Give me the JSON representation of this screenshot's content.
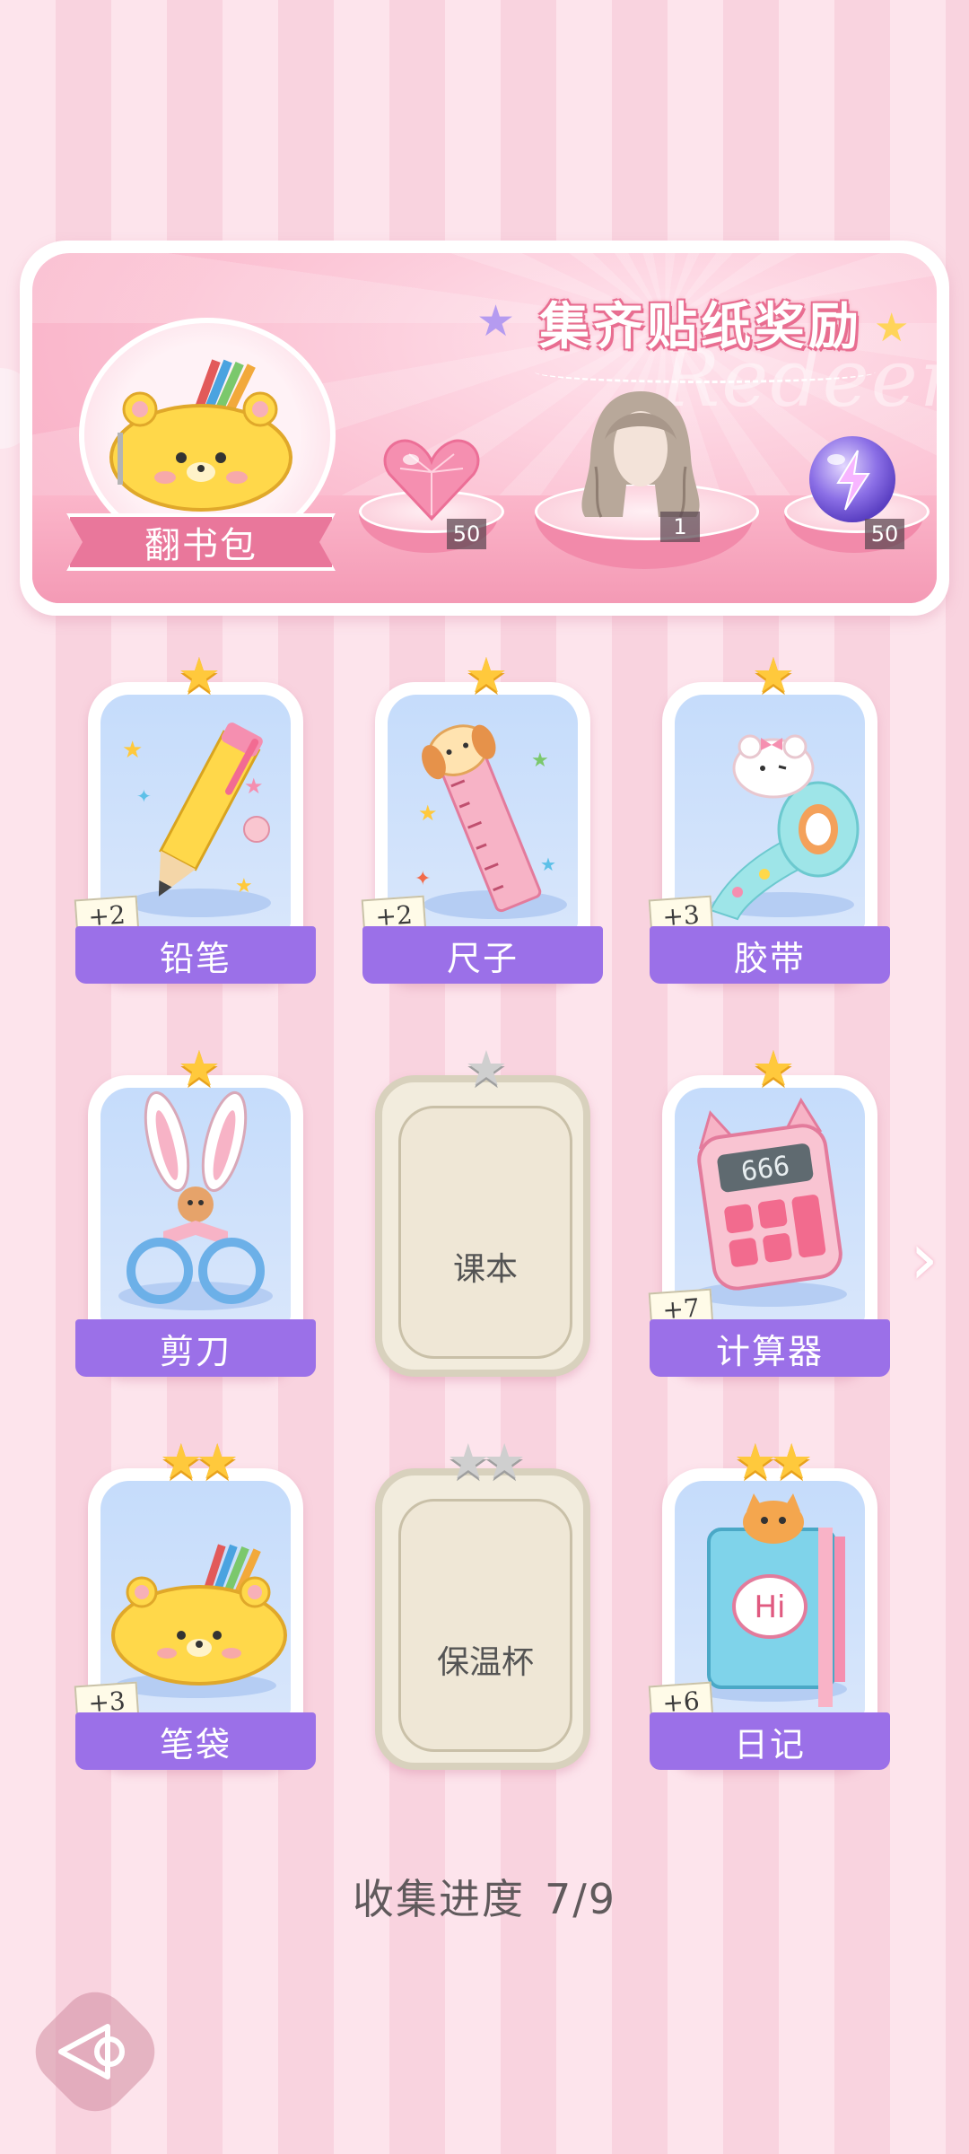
{
  "banner": {
    "title": "集齐贴纸奖励",
    "deco_text": "Redeem",
    "collection_name": "翻书包",
    "rewards": [
      {
        "name": "heart-gem-icon",
        "count": "50"
      },
      {
        "name": "hairstyle-icon",
        "count": "1"
      },
      {
        "name": "energy-orb-icon",
        "count": "50"
      }
    ]
  },
  "stickers": [
    {
      "name": "铅笔",
      "bonus": "+2",
      "stars": 1,
      "collected": true,
      "icon": "pencil-icon"
    },
    {
      "name": "尺子",
      "bonus": "+2",
      "stars": 1,
      "collected": true,
      "icon": "ruler-icon"
    },
    {
      "name": "胶带",
      "bonus": "+3",
      "stars": 1,
      "collected": true,
      "icon": "tape-icon"
    },
    {
      "name": "剪刀",
      "bonus": "",
      "stars": 1,
      "collected": true,
      "icon": "scissors-icon"
    },
    {
      "name": "课本",
      "bonus": "",
      "stars": 1,
      "collected": false,
      "icon": ""
    },
    {
      "name": "计算器",
      "bonus": "+7",
      "stars": 1,
      "collected": true,
      "icon": "calculator-icon",
      "display": "666"
    },
    {
      "name": "笔袋",
      "bonus": "+3",
      "stars": 2,
      "collected": true,
      "icon": "pencil-case-icon"
    },
    {
      "name": "保温杯",
      "bonus": "",
      "stars": 2,
      "collected": false,
      "icon": ""
    },
    {
      "name": "日记",
      "bonus": "+6",
      "stars": 2,
      "collected": true,
      "icon": "diary-icon",
      "display": "Hi"
    }
  ],
  "progress": {
    "label": "收集进度",
    "value": "7/9"
  },
  "colors": {
    "label_purple": "#9b70e8",
    "star_gold": "#ffc93c",
    "star_grey": "#cfcfcf",
    "banner_pink": "#f49ab5"
  }
}
